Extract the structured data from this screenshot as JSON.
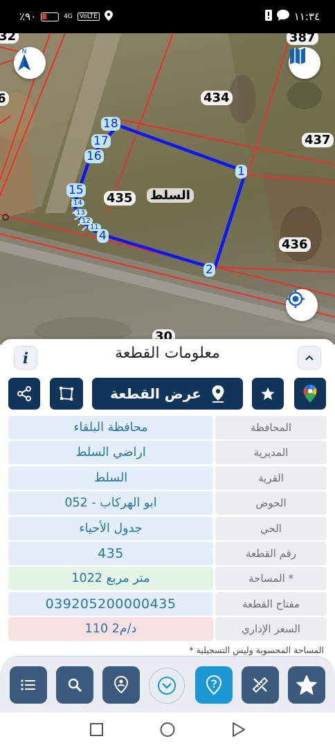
{
  "status_bar": {
    "battery_text": "٪٩٠",
    "network": "4G",
    "volte": "VoLTE",
    "time": "١١:٣٤"
  },
  "map": {
    "parcels": {
      "p32": "32",
      "p387": "387",
      "p434": "434",
      "p437": "437",
      "p435": "435",
      "p436": "436",
      "p30": "30",
      "p6": "6"
    },
    "vertices": {
      "v18": "18",
      "v17": "17",
      "v16": "16",
      "v15": "15",
      "v1": "1",
      "v2": "2",
      "v4": "4",
      "v14": "14",
      "v13": "13",
      "v12": "12",
      "v11": "11"
    },
    "village_label": "السلط",
    "compass_letter": "N",
    "colors": {
      "parcel_line": "#e8322c",
      "selected_outline": "#0a16ff"
    }
  },
  "sheet": {
    "title": "معلومات القطعة",
    "info_label": "i",
    "show_parcel_label": "عرض القطعة",
    "rows": [
      {
        "label": "المحافظة",
        "value": "محافظة البلقاء"
      },
      {
        "label": "المديرية",
        "value": "اراضي السلط"
      },
      {
        "label": "القرية",
        "value": "السلط"
      },
      {
        "label": "الحوض",
        "value": "ابو الهركاب - 052"
      },
      {
        "label": "الحي",
        "value": "جدول الأحياء"
      },
      {
        "label": "رقم القطعة",
        "value": "435"
      },
      {
        "label": "المساحة *",
        "value": "1022  متر مربع"
      },
      {
        "label": "مفتاح القطعة",
        "value": "039205200000435"
      },
      {
        "label": "السعر الإداري",
        "value": "110 د/م2"
      }
    ],
    "footnote": "* المساحة المحسوبة وليس التسجيلية"
  },
  "toolbar": {
    "icons": [
      "list-icon",
      "search-icon",
      "location-pin-icon",
      "chevron-down-icon",
      "question-pin-icon",
      "ruler-icon",
      "star-icon"
    ]
  }
}
